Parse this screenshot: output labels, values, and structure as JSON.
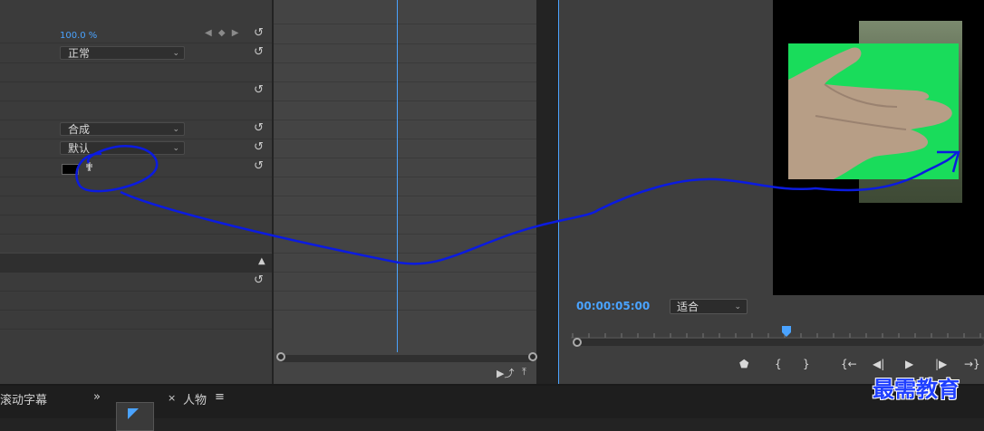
{
  "effects": {
    "opacity_value": "100.0 %",
    "keyframe_controls": "◀ ◆ ▶",
    "blend_mode": "正常",
    "composite": "合成",
    "default": "默认",
    "reset_symbol": "↺",
    "section_toggle": "▲"
  },
  "monitor": {
    "timecode": "00:00:05:00",
    "fit": "适合",
    "controls": {
      "marker": "⬟",
      "in_point": "{",
      "out_point": "}",
      "goto_in": "{←",
      "step_back": "◀|",
      "play": "▶",
      "step_forward": "|▶",
      "goto_out": "→}"
    }
  },
  "timeline": {
    "insert_icon": "▶⤴",
    "export_icon": "⤒"
  },
  "bottom": {
    "tab_titles": "滚动字幕",
    "chevrons": "»",
    "close": "×",
    "tab_people": "人物",
    "menu": "≡"
  },
  "watermark": "最需教育",
  "colors": {
    "accent": "#4aa3ff",
    "annotation": "#0b1be0",
    "green_screen": "#19dc5b"
  }
}
